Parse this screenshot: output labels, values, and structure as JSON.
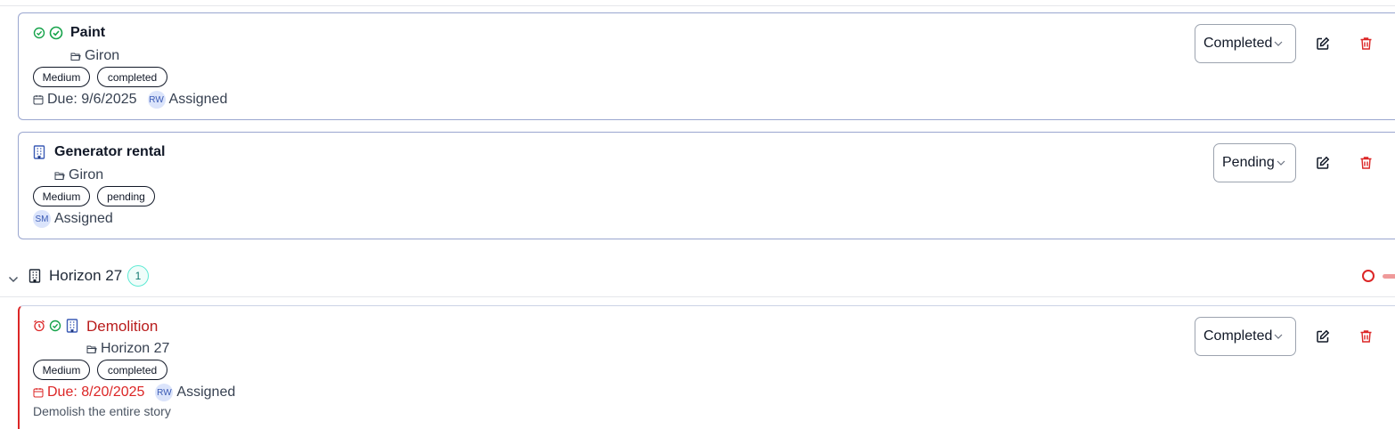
{
  "tasks": [
    {
      "title": "Paint",
      "project": "Giron",
      "priority": "Medium",
      "status_badge": "completed",
      "due": "Due: 9/6/2025",
      "assignee_initials": "RW",
      "assigned_label": "Assigned",
      "status_select": "Completed"
    },
    {
      "title": "Generator rental",
      "project": "Giron",
      "priority": "Medium",
      "status_badge": "pending",
      "assignee_initials": "SM",
      "assigned_label": "Assigned",
      "status_select": "Pending"
    },
    {
      "title": "Demolition",
      "project": "Horizon 27",
      "priority": "Medium",
      "status_badge": "completed",
      "due": "Due: 8/20/2025",
      "assignee_initials": "RW",
      "assigned_label": "Assigned",
      "description": "Demolish the entire story",
      "status_select": "Completed"
    }
  ],
  "group": {
    "name": "Horizon 27",
    "count": "1"
  },
  "colors": {
    "danger": "#dc2626",
    "success": "#16a34a",
    "accent_blue": "#3b5bb5",
    "teal": "#0f766e"
  }
}
